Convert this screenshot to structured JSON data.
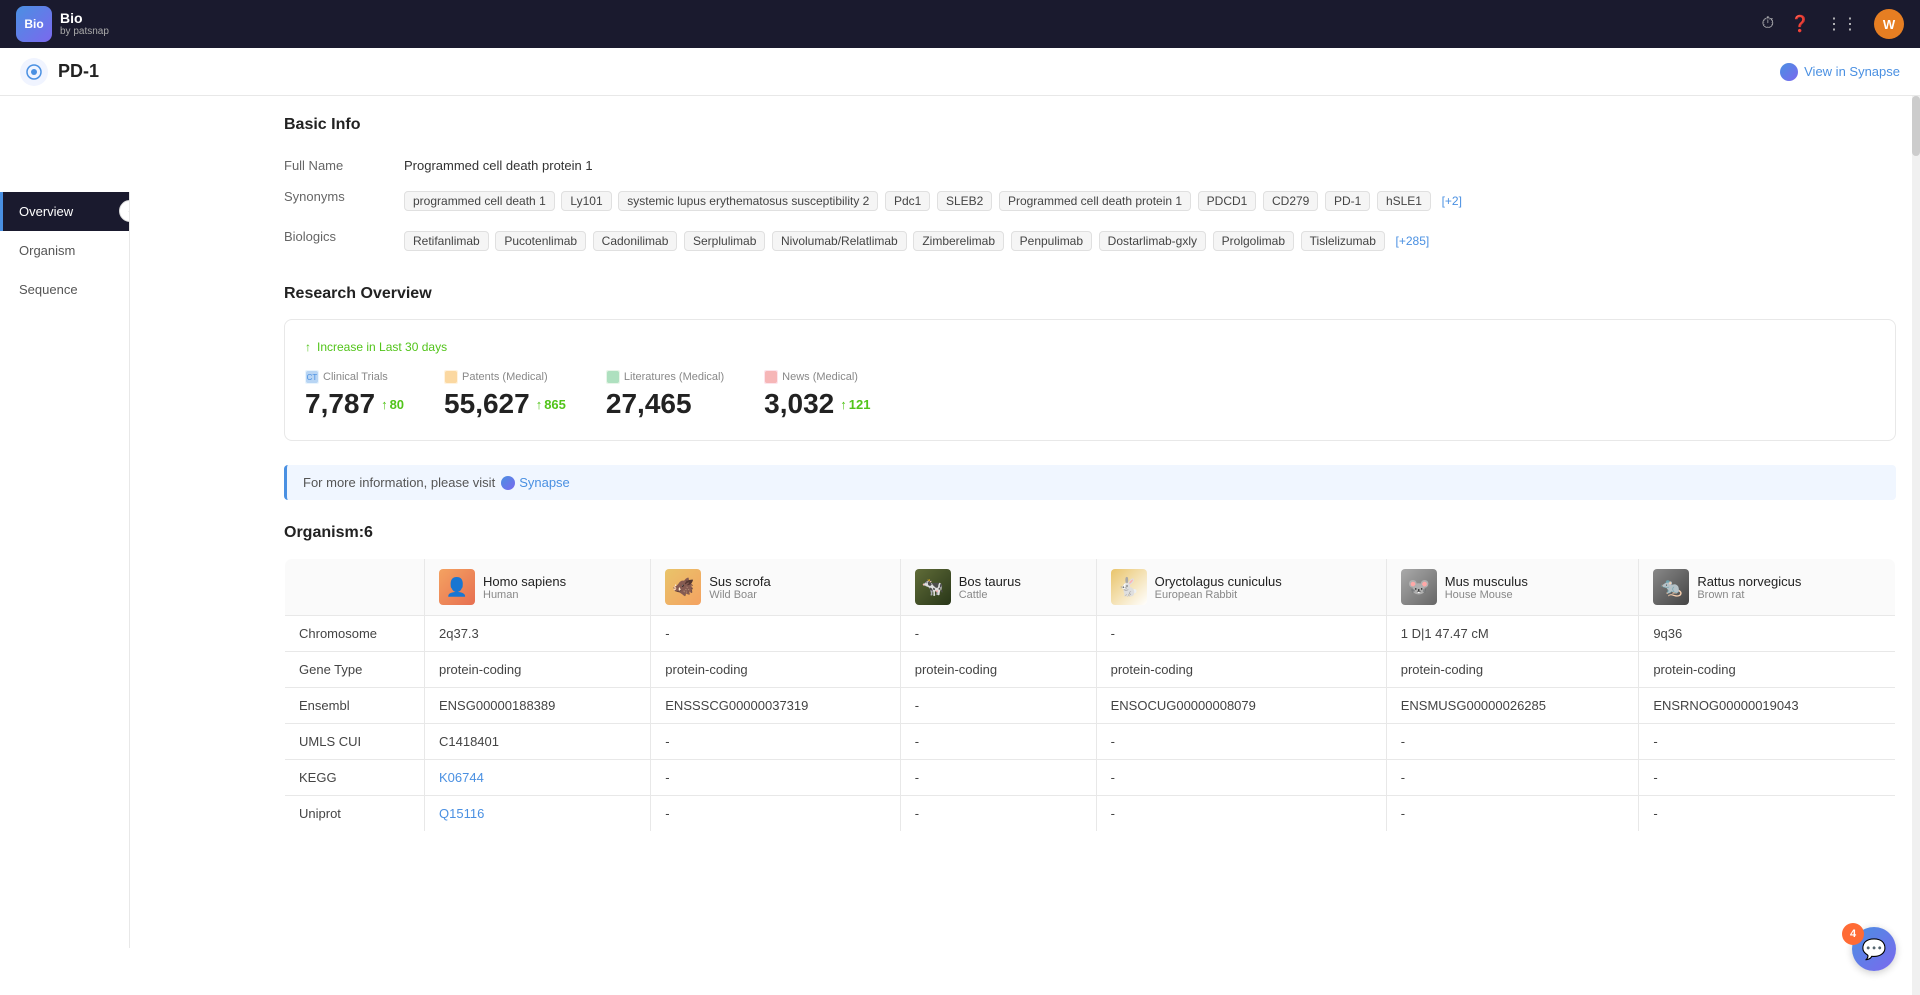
{
  "navbar": {
    "logo_text": "Bio",
    "brand_sub": "by patsnap",
    "avatar_letter": "W"
  },
  "page_header": {
    "title": "PD-1",
    "view_in_synapse": "View in Synapse"
  },
  "sidebar": {
    "items": [
      {
        "id": "overview",
        "label": "Overview",
        "active": true
      },
      {
        "id": "organism",
        "label": "Organism",
        "active": false
      },
      {
        "id": "sequence",
        "label": "Sequence",
        "active": false
      }
    ]
  },
  "basic_info": {
    "section_title": "Basic Info",
    "full_name_label": "Full Name",
    "full_name_value": "Programmed cell death protein 1",
    "synonyms_label": "Synonyms",
    "synonyms": [
      "programmed cell death 1",
      "Ly101",
      "systemic lupus erythematosus susceptibility 2",
      "Pdc1",
      "SLEB2",
      "Programmed cell death protein 1",
      "PDCD1",
      "CD279",
      "PD-1",
      "hSLE1"
    ],
    "synonyms_more": "[+2]",
    "biologics_label": "Biologics",
    "biologics": [
      "Retifanlimab",
      "Pucotenlimab",
      "Cadonilimab",
      "Serplulimab",
      "Nivolumab/Relatlimab",
      "Zimberelimab",
      "Penpulimab",
      "Dostarlimab-gxly",
      "Prolgolimab",
      "Tislelizumab"
    ],
    "biologics_more": "[+285]"
  },
  "research_overview": {
    "section_title": "Research Overview",
    "increase_label": "Increase in Last 30 days",
    "stats": [
      {
        "id": "clinical_trials",
        "type": "Clinical Trials",
        "value": "7,787",
        "delta": "80"
      },
      {
        "id": "patents",
        "type": "Patents (Medical)",
        "value": "55,627",
        "delta": "865"
      },
      {
        "id": "literatures",
        "type": "Literatures (Medical)",
        "value": "27,465",
        "delta": null
      },
      {
        "id": "news",
        "type": "News (Medical)",
        "value": "3,032",
        "delta": "121"
      }
    ],
    "info_banner": "For more information, please visit",
    "synapse_link": "Synapse"
  },
  "organism": {
    "section_title": "Organism:6",
    "columns": [
      {
        "id": "homo",
        "name": "Homo sapiens",
        "sub": "Human",
        "emoji": "👤"
      },
      {
        "id": "sus",
        "name": "Sus scrofa",
        "sub": "Wild Boar",
        "emoji": "🐗"
      },
      {
        "id": "bos",
        "name": "Bos taurus",
        "sub": "Cattle",
        "emoji": "🐄"
      },
      {
        "id": "ory",
        "name": "Oryctolagus cuniculus",
        "sub": "European Rabbit",
        "emoji": "🐇"
      },
      {
        "id": "mus",
        "name": "Mus musculus",
        "sub": "House Mouse",
        "emoji": "🐭"
      },
      {
        "id": "rat",
        "name": "Rattus norvegicus",
        "sub": "Brown rat",
        "emoji": "🐀"
      }
    ],
    "rows": [
      {
        "label": "Chromosome",
        "values": [
          "2q37.3",
          "-",
          "-",
          "-",
          "1 D|1 47.47 cM",
          "9q36"
        ]
      },
      {
        "label": "Gene Type",
        "values": [
          "protein-coding",
          "protein-coding",
          "protein-coding",
          "protein-coding",
          "protein-coding",
          "protein-coding"
        ]
      },
      {
        "label": "Ensembl",
        "values": [
          "ENSG00000188389",
          "ENSSSCG00000037319",
          "-",
          "ENSOCUG00000008079",
          "ENSMUSG00000026285",
          "ENSRNOG00000019043"
        ]
      },
      {
        "label": "UMLS CUI",
        "values": [
          "C1418401",
          "-",
          "-",
          "-",
          "-",
          "-"
        ]
      },
      {
        "label": "KEGG",
        "values": [
          "K06744",
          "-",
          "-",
          "-",
          "-",
          "-"
        ],
        "links": [
          true,
          false,
          false,
          false,
          false,
          false
        ]
      },
      {
        "label": "Uniprot",
        "values": [
          "Q15116",
          "-",
          "-",
          "-",
          "-",
          "-"
        ],
        "links": [
          true,
          false,
          false,
          false,
          false,
          false
        ]
      }
    ]
  },
  "chat": {
    "count": "4"
  }
}
